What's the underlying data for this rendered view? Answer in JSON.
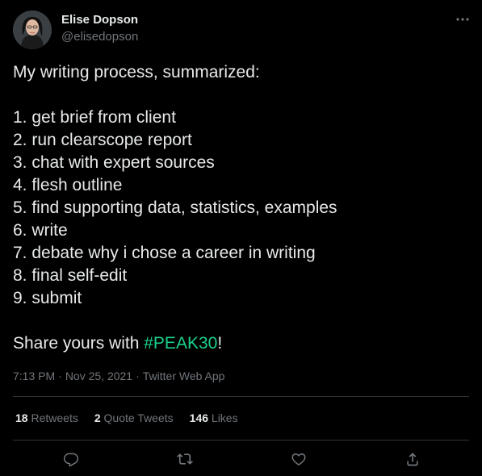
{
  "author": {
    "name": "Elise Dopson",
    "handle": "@elisedopson",
    "avatar_icon": "profile-photo"
  },
  "tweet": {
    "lines": [
      "My writing process, summarized:",
      "",
      "1. get brief from client",
      "2. run clearscope report",
      "3. chat with expert sources",
      "4. flesh outline",
      "5. find supporting data, statistics, examples",
      "6. write",
      "7. debate why i chose a career in writing",
      "8. final self-edit",
      "9. submit",
      ""
    ],
    "closing_prefix": "Share yours with ",
    "hashtag": "#PEAK30",
    "closing_suffix": "!"
  },
  "meta": {
    "time": "7:13 PM",
    "separator": "·",
    "date": "Nov 25, 2021",
    "source": "Twitter Web App"
  },
  "stats": {
    "retweets_count": "18",
    "retweets_label": "Retweets",
    "quote_count": "2",
    "quote_label": "Quote Tweets",
    "likes_count": "146",
    "likes_label": "Likes"
  },
  "actions": {
    "reply_icon": "reply-icon",
    "retweet_icon": "retweet-icon",
    "like_icon": "heart-icon",
    "share_icon": "share-icon"
  },
  "colors": {
    "background": "#000000",
    "text_primary": "#e7e9ea",
    "text_secondary": "#71767b",
    "hashtag": "#1ad08a",
    "divider": "#2f3336"
  }
}
